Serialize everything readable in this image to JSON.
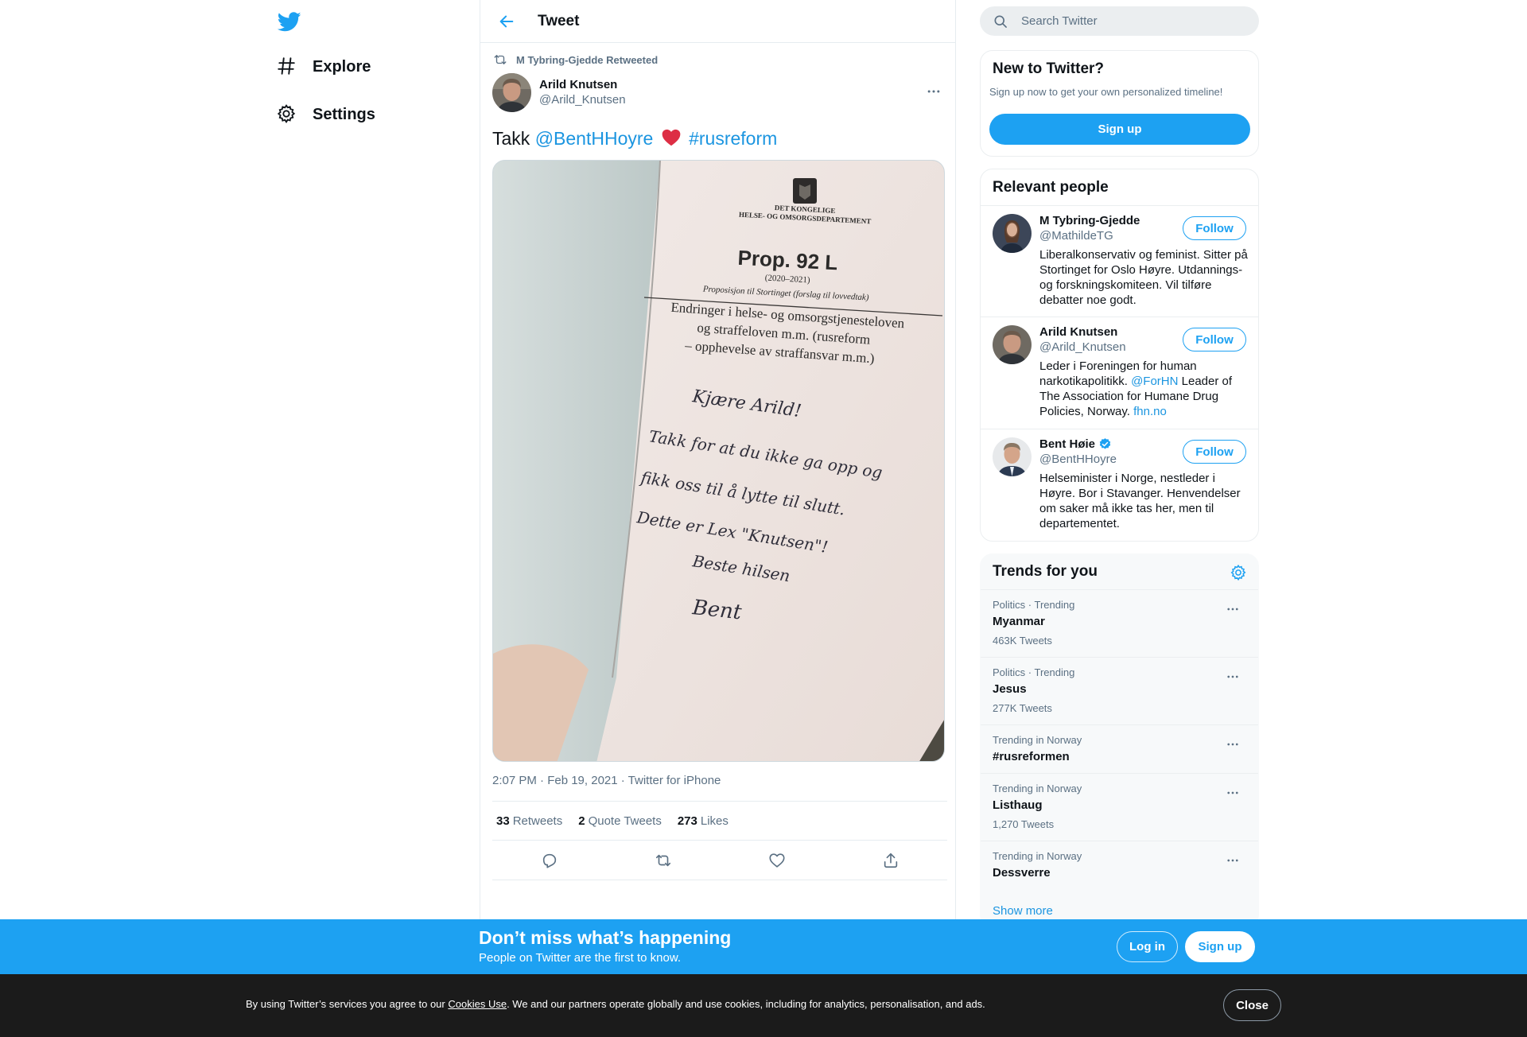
{
  "nav": {
    "logo_icon": "twitter-bird-icon",
    "items": [
      {
        "label": "Explore",
        "icon": "hashtag-icon"
      },
      {
        "label": "Settings",
        "icon": "gear-icon"
      }
    ]
  },
  "header": {
    "title": "Tweet",
    "back_icon": "arrow-left-icon"
  },
  "tweet": {
    "retweeted_by": "M Tybring-Gjedde Retweeted",
    "author_name": "Arild Knutsen",
    "author_handle": "@Arild_Knutsen",
    "text_prefix": "Takk ",
    "mention": "@BentHHoyre",
    "hashtag": "#rusreform",
    "timestamp": "2:07 PM · Feb 19, 2021 · Twitter for iPhone",
    "media": {
      "dept_line1": "DET KONGELIGE",
      "dept_line2": "HELSE- OG OMSORGSDEPARTEMENT",
      "prop_title": "Prop. 92 L",
      "prop_year": "(2020–2021)",
      "prop_sub": "Proposisjon til Stortinget (forslag til lovvedtak)",
      "heading_lines": [
        "Endringer i helse- og omsorgstjenesteloven",
        "og straffeloven m.m. (rusreform",
        "– opphevelse av straffansvar m.m.)"
      ],
      "handwriting_lines": [
        "Kjære Arild!",
        "Takk for at du ikke ga opp og",
        "fikk oss til å lytte til slutt.",
        "Dette er Lex \"Knutsen\"!",
        "Beste hilsen",
        "Bent"
      ]
    },
    "stats": [
      {
        "count": "33",
        "label": "Retweets"
      },
      {
        "count": "2",
        "label": "Quote Tweets"
      },
      {
        "count": "273",
        "label": "Likes"
      }
    ]
  },
  "search": {
    "placeholder": "Search Twitter"
  },
  "new_to_twitter": {
    "title": "New to Twitter?",
    "subtitle": "Sign up now to get your own personalized timeline!",
    "button": "Sign up"
  },
  "relevant_people": {
    "title": "Relevant people",
    "follow_label": "Follow",
    "people": [
      {
        "name": "M Tybring-Gjedde",
        "handle": "@MathildeTG",
        "verified": false,
        "bio": "Liberalkonservativ og feminist. Sitter på Stortinget for Oslo Høyre. Utdannings- og forskningskomiteen. Vil tilføre debatter noe godt."
      },
      {
        "name": "Arild Knutsen",
        "handle": "@Arild_Knutsen",
        "verified": false,
        "bio_part1": "Leder i Foreningen for human narkotikapolitikk. ",
        "bio_link1": "@ForHN",
        "bio_part2": " Leader of The Association for Humane Drug Policies, Norway. ",
        "bio_link2": "fhn.no"
      },
      {
        "name": "Bent Høie",
        "handle": "@BentHHoyre",
        "verified": true,
        "bio": "Helseminister i Norge, nestleder i Høyre. Bor i Stavanger. Henvendelser om saker må ikke tas her, men til departementet."
      }
    ]
  },
  "trends": {
    "title": "Trends for you",
    "items": [
      {
        "meta": "Politics · Trending",
        "name": "Myanmar",
        "count": "463K Tweets"
      },
      {
        "meta": "Politics · Trending",
        "name": "Jesus",
        "count": "277K Tweets"
      },
      {
        "meta": "Trending in Norway",
        "name": "#rusreformen",
        "count": ""
      },
      {
        "meta": "Trending in Norway",
        "name": "Listhaug",
        "count": "1,270 Tweets"
      },
      {
        "meta": "Trending in Norway",
        "name": "Dessverre",
        "count": ""
      }
    ],
    "show_more": "Show more"
  },
  "bottom_bar": {
    "title": "Don’t miss what’s happening",
    "subtitle": "People on Twitter are the first to know.",
    "login": "Log in",
    "signup": "Sign up"
  },
  "cookie": {
    "text_before": "By using Twitter’s services you agree to our ",
    "link": "Cookies Use",
    "text_after": ". We and our partners operate globally and use cookies, including for analytics, personalisation, and ads.",
    "close": "Close"
  },
  "colors": {
    "brand_blue": "#1da1f2",
    "link_blue": "#1b95e0",
    "secondary_text": "#5b7083",
    "heart_red": "#e0245e",
    "cookie_bg": "#1b1b1b"
  }
}
